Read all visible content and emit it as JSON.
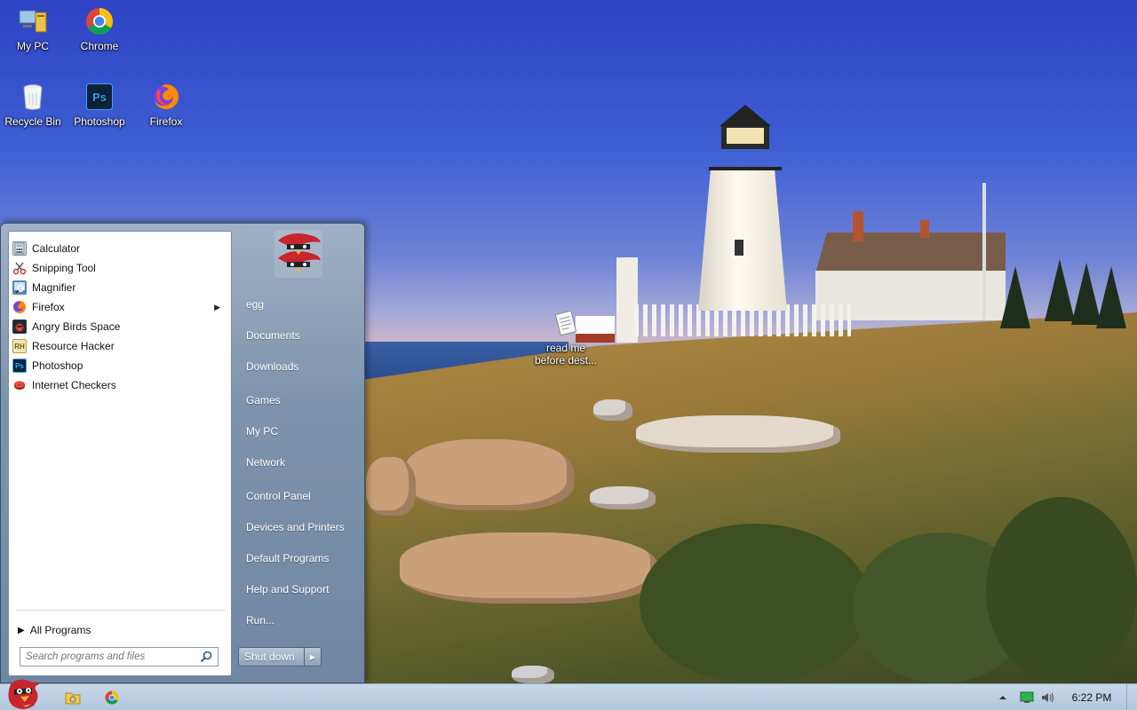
{
  "desktop": {
    "icons": [
      {
        "label": "My PC",
        "icon": "computer-icon"
      },
      {
        "label": "Chrome",
        "icon": "chrome-icon"
      },
      {
        "label": "Recycle Bin",
        "icon": "recycle-bin-icon"
      },
      {
        "label": "Photoshop",
        "icon": "photoshop-icon"
      },
      {
        "label": "Firefox",
        "icon": "firefox-icon"
      },
      {
        "label_line1": "read me",
        "label_line2": "before dest...",
        "icon": "document-icon"
      }
    ]
  },
  "start_menu": {
    "programs": [
      {
        "label": "Calculator",
        "icon": "calculator-icon"
      },
      {
        "label": "Snipping Tool",
        "icon": "scissors-icon"
      },
      {
        "label": "Magnifier",
        "icon": "magnifier-icon"
      },
      {
        "label": "Firefox",
        "icon": "firefox-icon",
        "submenu": true
      },
      {
        "label": "Angry Birds Space",
        "icon": "angry-birds-icon"
      },
      {
        "label": "Resource Hacker",
        "icon": "resource-hacker-icon"
      },
      {
        "label": "Photoshop",
        "icon": "photoshop-icon"
      },
      {
        "label": "Internet Checkers",
        "icon": "checkers-icon"
      }
    ],
    "all_programs_label": "All Programs",
    "search_placeholder": "Search programs and files",
    "right_items": {
      "user": "egg",
      "documents": "Documents",
      "downloads": "Downloads",
      "games": "Games",
      "my_pc": "My PC",
      "network": "Network",
      "control_panel": "Control Panel",
      "devices_printers": "Devices and Printers",
      "default_programs": "Default Programs",
      "help_support": "Help and Support",
      "run": "Run..."
    },
    "shutdown_label": "Shut down"
  },
  "taskbar": {
    "clock": "6:22 PM",
    "pinned": [
      "explorer-icon",
      "chrome-icon"
    ],
    "tray": [
      "show-hidden-icons-arrow",
      "network-icon",
      "volume-icon"
    ]
  },
  "colors": {
    "start_menu_glass": "#7d93ad",
    "taskbar": "#b2c6dc"
  }
}
